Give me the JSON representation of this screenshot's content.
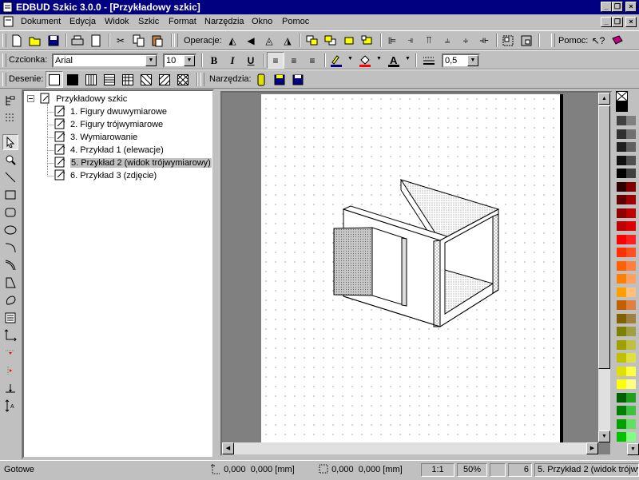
{
  "window": {
    "title": "EDBUD Szkic 3.0.0 - [Przykładowy szkic]"
  },
  "menu": {
    "items": [
      "Dokument",
      "Edycja",
      "Widok",
      "Szkic",
      "Format",
      "Narzędzia",
      "Okno",
      "Pomoc"
    ]
  },
  "toolbar1": {
    "operations_label": "Operacje:",
    "help_label": "Pomoc:"
  },
  "toolbar2": {
    "font_label": "Czcionka:",
    "font_value": "Arial",
    "size_value": "10",
    "bold": "B",
    "italic": "I",
    "underline": "U",
    "line_width_value": "0,5"
  },
  "toolbar3": {
    "patterns_label": "Desenie:",
    "tools_label": "Narzędzia:"
  },
  "tree": {
    "root": "Przykładowy szkic",
    "items": [
      "1. Figury dwuwymiarowe",
      "2. Figury trójwymiarowe",
      "3. Wymiarowanie",
      "4. Przykład 1 (elewacje)",
      "5. Przykład 2 (widok trójwymiarowy)",
      "6. Przykład 3 (zdjęcie)"
    ],
    "selected_index": 4
  },
  "status": {
    "message": "Gotowe",
    "cursor_pos": "0,000  0,000 [mm]",
    "size": "0,000  0,000 [mm]",
    "scale": "1:1",
    "zoom": "50%",
    "page": "6",
    "page_name": "5. Przykład 2 (widok trójwy"
  },
  "colors": {
    "titlebar": "#000080",
    "face": "#c0c0c0"
  }
}
